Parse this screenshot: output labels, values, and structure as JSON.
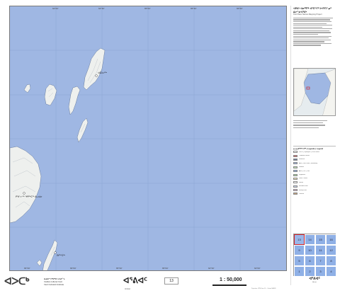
{
  "panel": {
    "title": "ᐊᑭᕕᒃ ᐊᓂᕐᕋᖅ ᐊᑦᑎᖏᑦ ᐅᕙᑦᑎᓐᓄᑦ ᐃᓕᓐᓂᐊᕐᕕᒃ",
    "subtitle": "Inuit Place Names Mapping Project"
  },
  "legend": {
    "title": "ᓇᓗᓇᐃᖅᓯᒋᐊᖅ | Legende | Legend",
    "items": [
      {
        "label": "ᐊᑦᑎᖅ | Toponyme | Place Name",
        "color": "#ffffff"
      },
      {
        "label": "Traditional routes",
        "color": "#d46b6b"
      },
      {
        "label": "Shoreline",
        "color": "#6b7fa0"
      },
      {
        "label": "ᐃᒪᖅ | Plan d'eau | Waterbody",
        "color": "#9fb7e3"
      },
      {
        "label": "Wetland",
        "color": "#bfe3b5"
      },
      {
        "label": "ᓇᔪᖅ | Lac | Lake",
        "color": "#8fb0e6"
      },
      {
        "label": "Vegetation",
        "color": "#a8d8a0"
      },
      {
        "label": "Sand / Gravel",
        "color": "#eee3b8"
      },
      {
        "label": "Glacier",
        "color": "#ffffff"
      },
      {
        "label": "Intertidal zone",
        "color": "#c7d4ee"
      },
      {
        "label": "Built-up area",
        "color": "#d9b8d0"
      },
      {
        "label": "Contour",
        "color": "#c8a27a"
      }
    ]
  },
  "map": {
    "water_color": "#9fb7e3",
    "land_color": "#eef0ee",
    "top_ticks": [
      "64°00'",
      "64°30'",
      "65°00'",
      "65°30'",
      "66°00'",
      "66°30'"
    ],
    "bottom_ticks": [
      "66°30'",
      "66°00'",
      "65°30'",
      "65°00'",
      "64°30'",
      "64°00'"
    ],
    "labels": [
      "ᐊᑕᐅᓯᖅ",
      "ᑭᖑᓪᓕᖅ ᕿᑭᖅᑕᖅ ᐃᓗᐊᓂ",
      "ᑎᑭᖅᑐᖅ"
    ]
  },
  "index": {
    "cells": [
      "13",
      "14",
      "15",
      "16",
      "9",
      "10",
      "11",
      "12",
      "5",
      "6",
      "7",
      "8",
      "1",
      "2",
      "3",
      "4"
    ],
    "title": "ᐊᕐᕕᐊᑦ",
    "subtitle": "Arviat"
  },
  "bottom": {
    "logo": "ᐊᐳᑕᒃ",
    "org_lines": [
      "ᐃᓄᐃᑦ ᐱᖃᑦᑕᐅᓯᒪᓂᖓ",
      "Institut culturel Inuit",
      "Inuit Cultural Institute"
    ],
    "sheet_name": "ᐊᕐᕕᐊᑦ",
    "sheet_name_latin": "Arviat",
    "sheet_number": "13",
    "scale": "1 : 50,000",
    "footer": "Projection: UTM Zone 15 — Datum NAD83"
  }
}
